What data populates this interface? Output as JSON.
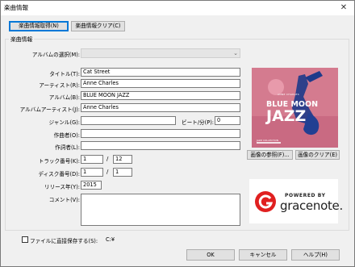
{
  "window": {
    "title": "楽曲情報",
    "close": "✕"
  },
  "top_buttons": {
    "fetch": "楽曲情報取得(N)",
    "clear": "楽曲情報クリア(C)"
  },
  "group": {
    "label": "楽曲情報"
  },
  "labels": {
    "album_select": "アルバムの選択(M):",
    "title": "タイトル(T):",
    "artist": "アーティスト(R):",
    "album": "アルバム(B):",
    "album_artist": "アルバムアーティスト(J):",
    "genre": "ジャンル(G):",
    "bpm": "ビート/分(P):",
    "composer": "作曲者(O):",
    "lyricist": "作詞者(L):",
    "track": "トラック番号(K):",
    "disc": "ディスク番号(D):",
    "year": "リリース年(Y):",
    "comment": "コメント(V):"
  },
  "values": {
    "album_select": "",
    "title": "Cat Street",
    "artist": "Anne Charles",
    "album": "BLUE MOON JAZZ",
    "album_artist": "Anne Charles",
    "genre": "",
    "bpm": "0",
    "composer": "",
    "lyricist": "",
    "track_num": "1",
    "track_total": "12",
    "disc_num": "1",
    "disc_total": "1",
    "year": "2015",
    "comment": ""
  },
  "slash": "/",
  "cover": {
    "line1": "BLUE MOON",
    "line2": "JAZZ",
    "small_top": "ANNE CHARLES",
    "small_bottom": "JAZZ COLLECTION"
  },
  "image_buttons": {
    "browse": "画像の参照(F)...",
    "clear": "画像のクリア(E)"
  },
  "gracenote": {
    "powered": "POWERED BY",
    "name": "gracenote."
  },
  "save_checkbox": {
    "label": "ファイルに直接保存する(S):",
    "value": "C:¥",
    "checked": false
  },
  "bottom_buttons": {
    "ok": "OK",
    "cancel": "キャンセル",
    "help": "ヘルプ(H)"
  },
  "colors": {
    "accent": "#0078d7",
    "cover_bg": "#d47b8f",
    "cover_text": "#1d3a8a",
    "gracenote_red": "#e02020"
  }
}
